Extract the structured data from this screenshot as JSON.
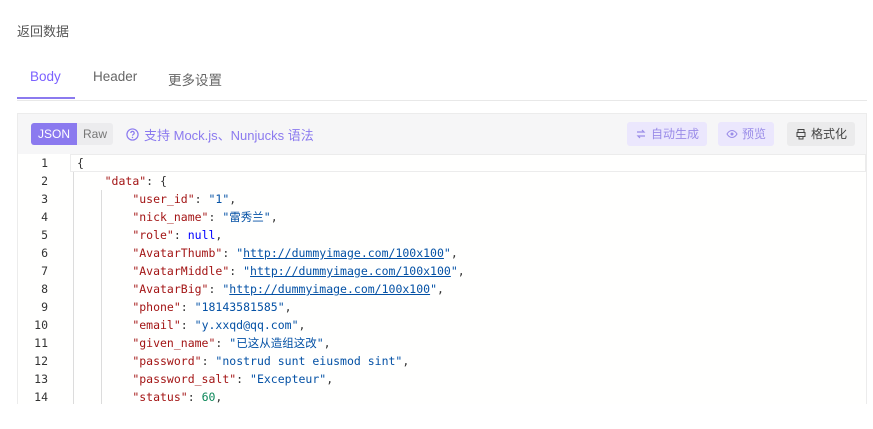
{
  "section": {
    "title": "返回数据"
  },
  "tabs": [
    {
      "label": "Body"
    },
    {
      "label": "Header"
    },
    {
      "label": "更多设置"
    }
  ],
  "toolbar": {
    "json_label": "JSON",
    "raw_label": "Raw",
    "mock_tip": "支持 Mock.js、Nunjucks 语法",
    "auto_generate_label": "自动生成",
    "preview_label": "预览",
    "format_label": "格式化"
  },
  "colors": {
    "accent": "#7b61ff",
    "key": "#a31515",
    "string": "#0451a5",
    "number": "#098658",
    "keyword": "#0000ff"
  },
  "code": {
    "line_numbers": [
      "1",
      "2",
      "3",
      "4",
      "5",
      "6",
      "7",
      "8",
      "9",
      "10",
      "11",
      "12",
      "13",
      "14"
    ],
    "lines": [
      {
        "indent": "",
        "parts": [
          {
            "t": "pun",
            "v": "{"
          }
        ]
      },
      {
        "indent": "    ",
        "parts": [
          {
            "t": "key",
            "v": "\"data\""
          },
          {
            "t": "pun",
            "v": ": {"
          }
        ]
      },
      {
        "indent": "        ",
        "parts": [
          {
            "t": "key",
            "v": "\"user_id\""
          },
          {
            "t": "pun",
            "v": ": "
          },
          {
            "t": "str",
            "v": "\"1\""
          },
          {
            "t": "pun",
            "v": ","
          }
        ]
      },
      {
        "indent": "        ",
        "parts": [
          {
            "t": "key",
            "v": "\"nick_name\""
          },
          {
            "t": "pun",
            "v": ": "
          },
          {
            "t": "str",
            "v": "\"雷秀兰\""
          },
          {
            "t": "pun",
            "v": ","
          }
        ]
      },
      {
        "indent": "        ",
        "parts": [
          {
            "t": "key",
            "v": "\"role\""
          },
          {
            "t": "pun",
            "v": ": "
          },
          {
            "t": "kw",
            "v": "null"
          },
          {
            "t": "pun",
            "v": ","
          }
        ]
      },
      {
        "indent": "        ",
        "parts": [
          {
            "t": "key",
            "v": "\"AvatarThumb\""
          },
          {
            "t": "pun",
            "v": ": "
          },
          {
            "t": "str",
            "v": "\""
          },
          {
            "t": "url",
            "v": "http://dummyimage.com/100x100"
          },
          {
            "t": "str",
            "v": "\""
          },
          {
            "t": "pun",
            "v": ","
          }
        ]
      },
      {
        "indent": "        ",
        "parts": [
          {
            "t": "key",
            "v": "\"AvatarMiddle\""
          },
          {
            "t": "pun",
            "v": ": "
          },
          {
            "t": "str",
            "v": "\""
          },
          {
            "t": "url",
            "v": "http://dummyimage.com/100x100"
          },
          {
            "t": "str",
            "v": "\""
          },
          {
            "t": "pun",
            "v": ","
          }
        ]
      },
      {
        "indent": "        ",
        "parts": [
          {
            "t": "key",
            "v": "\"AvatarBig\""
          },
          {
            "t": "pun",
            "v": ": "
          },
          {
            "t": "str",
            "v": "\""
          },
          {
            "t": "url",
            "v": "http://dummyimage.com/100x100"
          },
          {
            "t": "str",
            "v": "\""
          },
          {
            "t": "pun",
            "v": ","
          }
        ]
      },
      {
        "indent": "        ",
        "parts": [
          {
            "t": "key",
            "v": "\"phone\""
          },
          {
            "t": "pun",
            "v": ": "
          },
          {
            "t": "str",
            "v": "\"18143581585\""
          },
          {
            "t": "pun",
            "v": ","
          }
        ]
      },
      {
        "indent": "        ",
        "parts": [
          {
            "t": "key",
            "v": "\"email\""
          },
          {
            "t": "pun",
            "v": ": "
          },
          {
            "t": "str",
            "v": "\"y.xxqd@qq.com\""
          },
          {
            "t": "pun",
            "v": ","
          }
        ]
      },
      {
        "indent": "        ",
        "parts": [
          {
            "t": "key",
            "v": "\"given_name\""
          },
          {
            "t": "pun",
            "v": ": "
          },
          {
            "t": "str",
            "v": "\"已这从造组这改\""
          },
          {
            "t": "pun",
            "v": ","
          }
        ]
      },
      {
        "indent": "        ",
        "parts": [
          {
            "t": "key",
            "v": "\"password\""
          },
          {
            "t": "pun",
            "v": ": "
          },
          {
            "t": "str",
            "v": "\"nostrud sunt eiusmod sint\""
          },
          {
            "t": "pun",
            "v": ","
          }
        ]
      },
      {
        "indent": "        ",
        "parts": [
          {
            "t": "key",
            "v": "\"password_salt\""
          },
          {
            "t": "pun",
            "v": ": "
          },
          {
            "t": "str",
            "v": "\"Excepteur\""
          },
          {
            "t": "pun",
            "v": ","
          }
        ]
      },
      {
        "indent": "        ",
        "parts": [
          {
            "t": "key",
            "v": "\"status\""
          },
          {
            "t": "pun",
            "v": ": "
          },
          {
            "t": "num",
            "v": "60"
          },
          {
            "t": "pun",
            "v": ","
          }
        ]
      }
    ]
  }
}
